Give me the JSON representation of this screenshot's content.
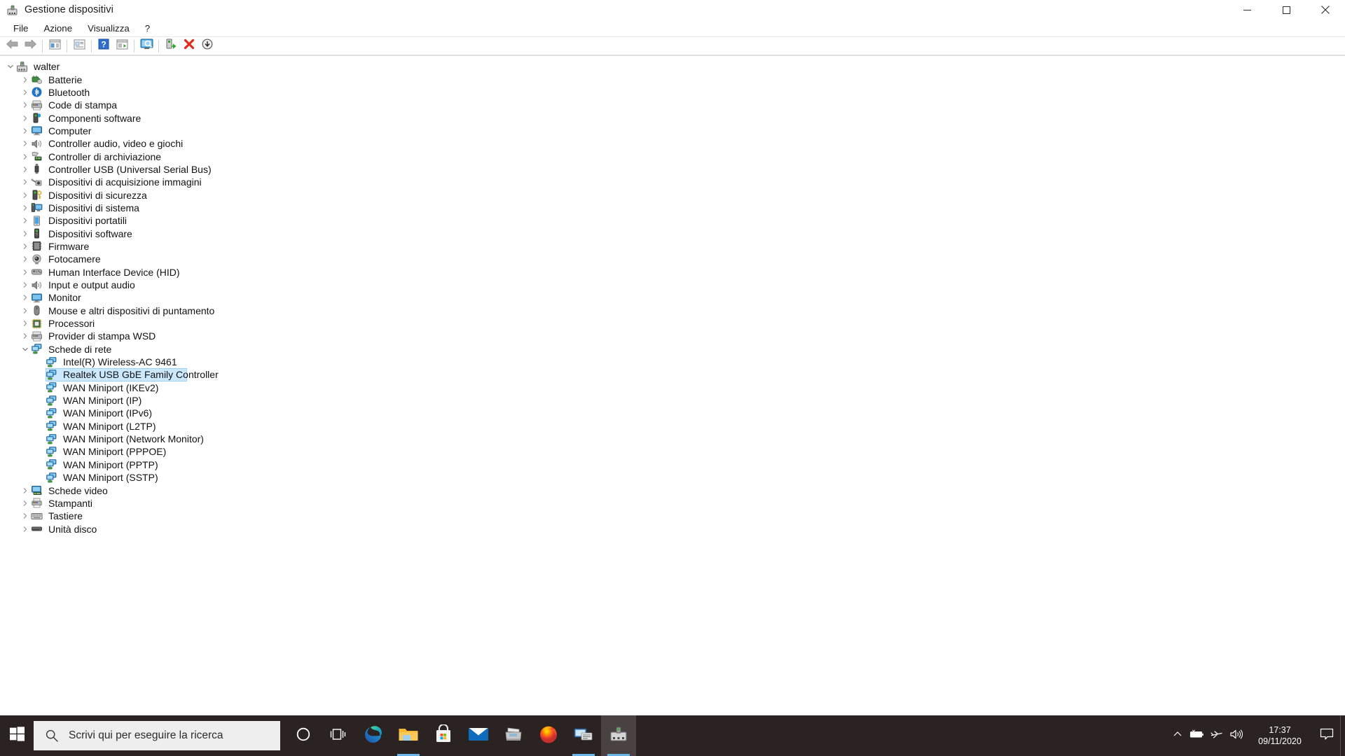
{
  "window": {
    "title": "Gestione dispositivi",
    "icon": "device-manager-icon",
    "controls": {
      "minimize": "minimize-button",
      "maximize": "maximize-button",
      "close": "close-button"
    }
  },
  "menubar": {
    "items": [
      {
        "label": "File",
        "name": "menu-file"
      },
      {
        "label": "Azione",
        "name": "menu-azione"
      },
      {
        "label": "Visualizza",
        "name": "menu-visualizza"
      },
      {
        "label": "?",
        "name": "menu-help"
      }
    ]
  },
  "toolbar": {
    "buttons": [
      {
        "name": "back-button",
        "icon": "back-arrow-icon"
      },
      {
        "name": "forward-button",
        "icon": "forward-arrow-icon"
      },
      {
        "name": "show-hide-console-tree-button",
        "icon": "console-tree-icon"
      },
      {
        "name": "properties-button",
        "icon": "properties-icon"
      },
      {
        "name": "help-button",
        "icon": "question-mark-icon"
      },
      {
        "name": "show-hide-action-pane-button",
        "icon": "action-pane-icon"
      },
      {
        "name": "scan-hardware-changes-button",
        "icon": "monitor-scan-icon"
      },
      {
        "name": "update-driver-button",
        "icon": "update-driver-icon"
      },
      {
        "name": "uninstall-device-button",
        "icon": "red-x-icon"
      },
      {
        "name": "disable-device-button",
        "icon": "down-arrow-circle-icon"
      }
    ]
  },
  "tree": {
    "selected_label": "Realtek USB GbE Family Controller",
    "nodes": [
      {
        "label": "walter",
        "level": 0,
        "icon": "computer-root-icon",
        "state": "expanded"
      },
      {
        "label": "Batterie",
        "level": 1,
        "icon": "battery-icon",
        "state": "collapsed"
      },
      {
        "label": "Bluetooth",
        "level": 1,
        "icon": "bluetooth-icon",
        "state": "collapsed"
      },
      {
        "label": "Code di stampa",
        "level": 1,
        "icon": "print-queue-icon",
        "state": "collapsed"
      },
      {
        "label": "Componenti software",
        "level": 1,
        "icon": "software-component-icon",
        "state": "collapsed"
      },
      {
        "label": "Computer",
        "level": 1,
        "icon": "monitor-icon",
        "state": "collapsed"
      },
      {
        "label": "Controller audio, video e giochi",
        "level": 1,
        "icon": "speaker-icon",
        "state": "collapsed"
      },
      {
        "label": "Controller di archiviazione",
        "level": 1,
        "icon": "storage-controller-icon",
        "state": "collapsed"
      },
      {
        "label": "Controller USB (Universal Serial Bus)",
        "level": 1,
        "icon": "usb-icon",
        "state": "collapsed"
      },
      {
        "label": "Dispositivi di acquisizione immagini",
        "level": 1,
        "icon": "imaging-device-icon",
        "state": "collapsed"
      },
      {
        "label": "Dispositivi di sicurezza",
        "level": 1,
        "icon": "security-key-icon",
        "state": "collapsed"
      },
      {
        "label": "Dispositivi di sistema",
        "level": 1,
        "icon": "system-device-icon",
        "state": "collapsed"
      },
      {
        "label": "Dispositivi portatili",
        "level": 1,
        "icon": "portable-device-icon",
        "state": "collapsed"
      },
      {
        "label": "Dispositivi software",
        "level": 1,
        "icon": "software-device-icon",
        "state": "collapsed"
      },
      {
        "label": "Firmware",
        "level": 1,
        "icon": "firmware-chip-icon",
        "state": "collapsed"
      },
      {
        "label": "Fotocamere",
        "level": 1,
        "icon": "camera-icon",
        "state": "collapsed"
      },
      {
        "label": "Human Interface Device (HID)",
        "level": 1,
        "icon": "hid-icon",
        "state": "collapsed"
      },
      {
        "label": "Input e output audio",
        "level": 1,
        "icon": "speaker-icon",
        "state": "collapsed"
      },
      {
        "label": "Monitor",
        "level": 1,
        "icon": "monitor-icon",
        "state": "collapsed"
      },
      {
        "label": "Mouse e altri dispositivi di puntamento",
        "level": 1,
        "icon": "mouse-icon",
        "state": "collapsed"
      },
      {
        "label": "Processori",
        "level": 1,
        "icon": "processor-icon",
        "state": "collapsed"
      },
      {
        "label": "Provider di stampa WSD",
        "level": 1,
        "icon": "print-queue-icon",
        "state": "collapsed"
      },
      {
        "label": "Schede di rete",
        "level": 1,
        "icon": "network-adapter-icon",
        "state": "expanded"
      },
      {
        "label": "Intel(R) Wireless-AC 9461",
        "level": 2,
        "icon": "network-adapter-icon",
        "state": "leaf"
      },
      {
        "label": "Realtek USB GbE Family Controller",
        "level": 2,
        "icon": "network-adapter-icon",
        "state": "leaf",
        "selected": true
      },
      {
        "label": "WAN Miniport (IKEv2)",
        "level": 2,
        "icon": "network-adapter-icon",
        "state": "leaf"
      },
      {
        "label": "WAN Miniport (IP)",
        "level": 2,
        "icon": "network-adapter-icon",
        "state": "leaf"
      },
      {
        "label": "WAN Miniport (IPv6)",
        "level": 2,
        "icon": "network-adapter-icon",
        "state": "leaf"
      },
      {
        "label": "WAN Miniport (L2TP)",
        "level": 2,
        "icon": "network-adapter-icon",
        "state": "leaf"
      },
      {
        "label": "WAN Miniport (Network Monitor)",
        "level": 2,
        "icon": "network-adapter-icon",
        "state": "leaf"
      },
      {
        "label": "WAN Miniport (PPPOE)",
        "level": 2,
        "icon": "network-adapter-icon",
        "state": "leaf"
      },
      {
        "label": "WAN Miniport (PPTP)",
        "level": 2,
        "icon": "network-adapter-icon",
        "state": "leaf"
      },
      {
        "label": "WAN Miniport (SSTP)",
        "level": 2,
        "icon": "network-adapter-icon",
        "state": "leaf"
      },
      {
        "label": "Schede video",
        "level": 1,
        "icon": "display-adapter-icon",
        "state": "collapsed"
      },
      {
        "label": "Stampanti",
        "level": 1,
        "icon": "printer-icon",
        "state": "collapsed"
      },
      {
        "label": "Tastiere",
        "level": 1,
        "icon": "keyboard-icon",
        "state": "collapsed"
      },
      {
        "label": "Unità disco",
        "level": 1,
        "icon": "disk-drive-icon",
        "state": "collapsed"
      }
    ]
  },
  "taskbar": {
    "start": "start-button",
    "search": {
      "placeholder": "Scrivi qui per eseguire la ricerca",
      "icon": "search-icon"
    },
    "items": [
      {
        "name": "taskbar-cortana",
        "icon": "cortana-circle-icon",
        "active": false
      },
      {
        "name": "taskbar-task-view",
        "icon": "task-view-icon",
        "active": false
      },
      {
        "name": "taskbar-edge",
        "icon": "edge-icon",
        "active": false
      },
      {
        "name": "taskbar-file-explorer",
        "icon": "folder-icon",
        "active": false,
        "running": true
      },
      {
        "name": "taskbar-microsoft-store",
        "icon": "store-bag-icon",
        "active": false
      },
      {
        "name": "taskbar-mail",
        "icon": "mail-envelope-icon",
        "active": false
      },
      {
        "name": "taskbar-fax-scan",
        "icon": "fax-scanner-icon",
        "active": false
      },
      {
        "name": "taskbar-firefox",
        "icon": "firefox-icon",
        "active": false
      },
      {
        "name": "taskbar-remote-desktop",
        "icon": "remote-desktop-icon",
        "active": false,
        "running": true
      },
      {
        "name": "taskbar-device-manager",
        "icon": "device-manager-icon",
        "active": true,
        "running": true
      }
    ],
    "tray": [
      {
        "name": "tray-show-hidden-icons",
        "icon": "chevron-up-icon"
      },
      {
        "name": "tray-battery",
        "icon": "battery-icon"
      },
      {
        "name": "tray-airplane-mode",
        "icon": "airplane-icon"
      },
      {
        "name": "tray-volume",
        "icon": "speaker-volume-icon"
      }
    ],
    "clock": {
      "time": "17:37",
      "date": "09/11/2020"
    },
    "notifications": {
      "name": "action-center-button",
      "icon": "speech-bubble-icon"
    }
  },
  "colors": {
    "selection_fill": "#cce8ff",
    "selection_border": "#99d1ff",
    "taskbar_bg": "#2b2321",
    "search_bg": "#eeeeee",
    "accent_underline": "#6bb5e8"
  }
}
